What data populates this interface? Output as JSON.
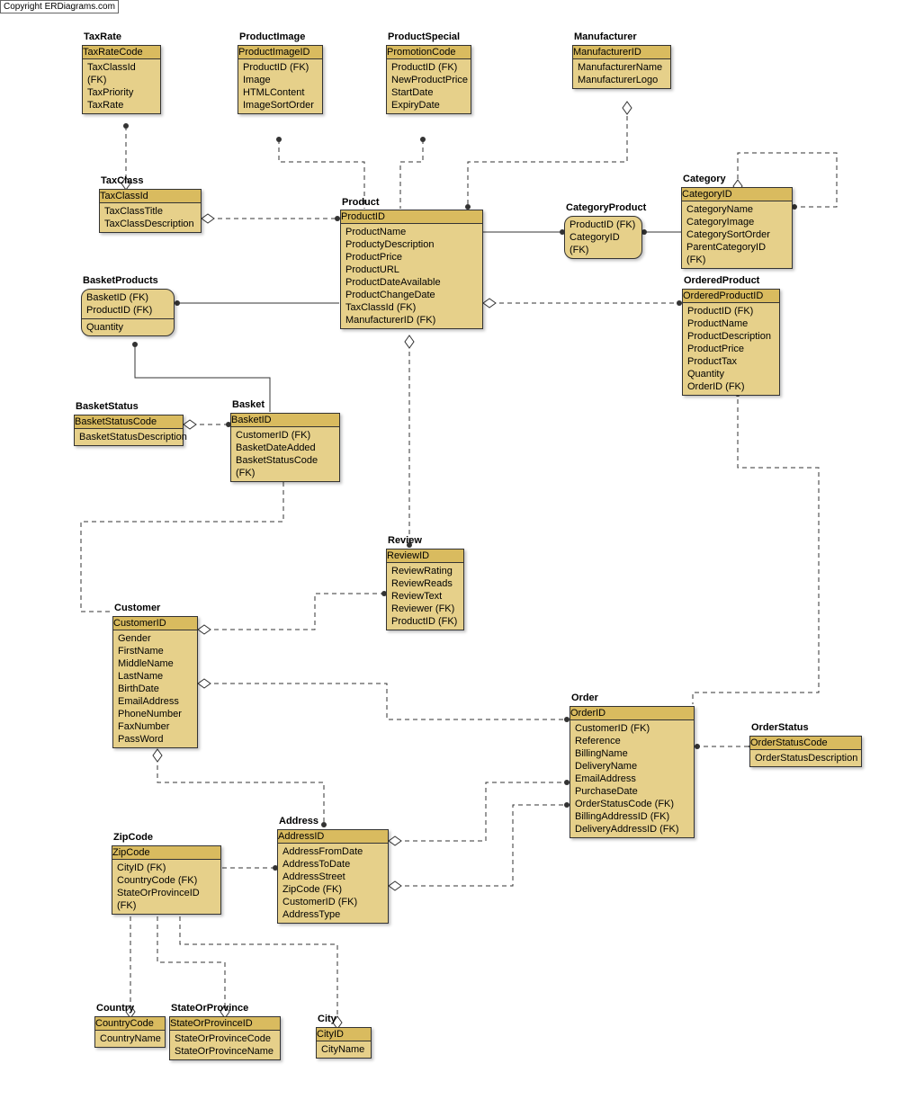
{
  "copyright": "Copyright ERDiagrams.com",
  "entities": {
    "TaxRate": {
      "title": "TaxRate",
      "pk": "TaxRateCode",
      "attrs": [
        "TaxClassId (FK)",
        "TaxPriority",
        "TaxRate"
      ]
    },
    "ProductImage": {
      "title": "ProductImage",
      "pk": "ProductImageID",
      "attrs": [
        "ProductID (FK)",
        "Image",
        "HTMLContent",
        "ImageSortOrder"
      ]
    },
    "ProductSpecial": {
      "title": "ProductSpecial",
      "pk": "PromotionCode",
      "attrs": [
        "ProductID (FK)",
        "NewProductPrice",
        "StartDate",
        "ExpiryDate"
      ]
    },
    "Manufacturer": {
      "title": "Manufacturer",
      "pk": "ManufacturerID",
      "attrs": [
        "ManufacturerName",
        "ManufacturerLogo"
      ]
    },
    "Category": {
      "title": "Category",
      "pk": "CategoryID",
      "attrs": [
        "CategoryName",
        "CategoryImage",
        "CategorySortOrder",
        "ParentCategoryID (FK)"
      ]
    },
    "TaxClass": {
      "title": "TaxClass",
      "pk": "TaxClassId",
      "attrs": [
        "TaxClassTitle",
        "TaxClassDescription"
      ]
    },
    "Product": {
      "title": "Product",
      "pk": "ProductID",
      "attrs": [
        "ProductName",
        "ProductyDescription",
        "ProductPrice",
        "ProductURL",
        "ProductDateAvailable",
        "ProductChangeDate",
        "TaxClassId (FK)",
        "ManufacturerID (FK)"
      ]
    },
    "CategoryProduct": {
      "title": "CategoryProduct",
      "pk": "",
      "attrs": [
        "ProductID (FK)",
        "CategoryID (FK)"
      ]
    },
    "BasketProducts": {
      "title": "BasketProducts",
      "pk": "",
      "attrs": [
        "BasketID (FK)",
        "ProductID (FK)"
      ],
      "extra": [
        "Quantity"
      ]
    },
    "OrderedProduct": {
      "title": "OrderedProduct",
      "pk": "OrderedProductID",
      "attrs": [
        "ProductID (FK)",
        "ProductName",
        "ProductDescription",
        "ProductPrice",
        "ProductTax",
        "Quantity",
        "OrderID (FK)"
      ]
    },
    "BasketStatus": {
      "title": "BasketStatus",
      "pk": "BasketStatusCode",
      "attrs": [
        "BasketStatusDescription"
      ]
    },
    "Basket": {
      "title": "Basket",
      "pk": "BasketID",
      "attrs": [
        "CustomerID (FK)",
        "BasketDateAdded",
        "BasketStatusCode (FK)"
      ]
    },
    "Review": {
      "title": "Review",
      "pk": "ReviewID",
      "attrs": [
        "ReviewRating",
        "ReviewReads",
        "ReviewText",
        "Reviewer (FK)",
        "ProductID (FK)"
      ]
    },
    "Customer": {
      "title": "Customer",
      "pk": "CustomerID",
      "attrs": [
        "Gender",
        "FirstName",
        "MiddleName",
        "LastName",
        "BirthDate",
        "EmailAddress",
        "PhoneNumber",
        "FaxNumber",
        "PassWord"
      ]
    },
    "Order": {
      "title": "Order",
      "pk": "OrderID",
      "attrs": [
        "CustomerID (FK)",
        "Reference",
        "BillingName",
        "DeliveryName",
        "EmailAddress",
        "PurchaseDate",
        "OrderStatusCode (FK)",
        "BillingAddressID (FK)",
        "DeliveryAddressID (FK)"
      ]
    },
    "OrderStatus": {
      "title": "OrderStatus",
      "pk": "OrderStatusCode",
      "attrs": [
        "OrderStatusDescription"
      ]
    },
    "ZipCode": {
      "title": "ZipCode",
      "pk": "ZipCode",
      "attrs": [
        "CityID (FK)",
        "CountryCode (FK)",
        "StateOrProvinceID (FK)"
      ]
    },
    "Address": {
      "title": "Address",
      "pk": "AddressID",
      "attrs": [
        "AddressFromDate",
        "AddressToDate",
        "AddressStreet",
        "ZipCode (FK)",
        "CustomerID (FK)",
        "AddressType"
      ]
    },
    "Country": {
      "title": "Country",
      "pk": "CountryCode",
      "attrs": [
        "CountryName"
      ]
    },
    "StateOrProvince": {
      "title": "StateOrProvince",
      "pk": "StateOrProvinceID",
      "attrs": [
        "StateOrProvinceCode",
        "StateOrProvinceName"
      ]
    },
    "City": {
      "title": "City",
      "pk": "CityID",
      "attrs": [
        "CityName"
      ]
    }
  }
}
